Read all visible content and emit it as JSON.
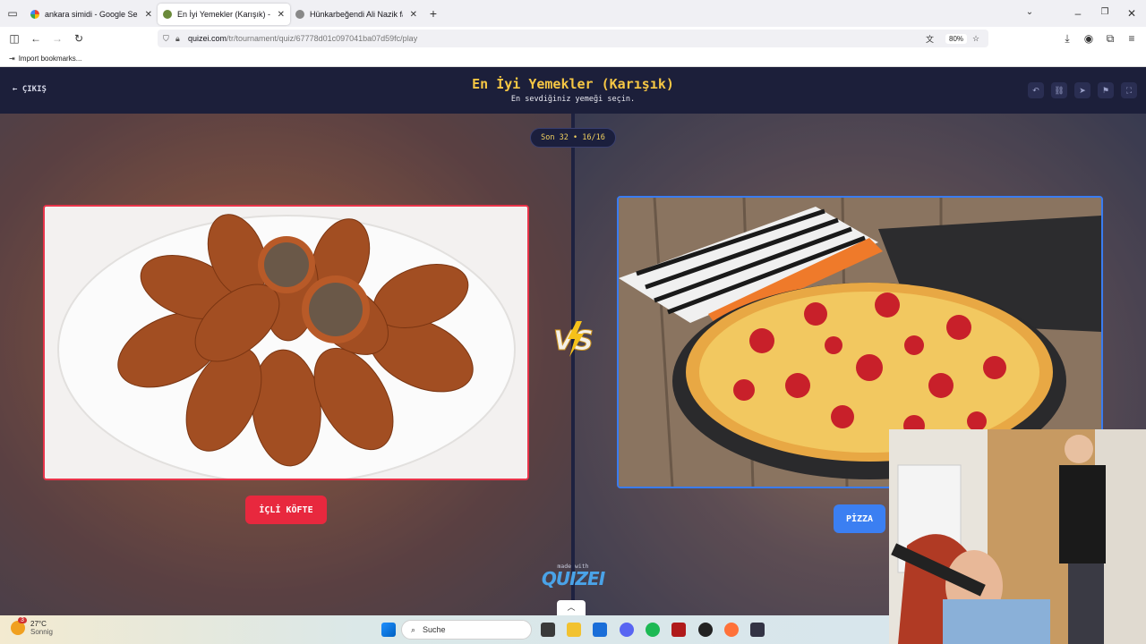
{
  "browser": {
    "tabs": [
      {
        "title": "ankara simidi - Google Search",
        "active": false
      },
      {
        "title": "En İyi Yemekler (Karışık) - Quizei",
        "active": true
      },
      {
        "title": "Hünkarbeğendi Ali Nazik farkı",
        "active": false
      }
    ],
    "url_host": "quizei.com",
    "url_path": "/tr/tournament/quiz/67778d01c097041ba07d59fc/play",
    "zoom": "80%",
    "bookmark_import": "Import bookmarks..."
  },
  "quiz": {
    "exit_label": "ÇIKIŞ",
    "title": "En İyi Yemekler (Karışık)",
    "subtitle": "En sevdiğiniz yemeği seçin.",
    "round": "Son 32 • 16/16",
    "vs_label": "VS",
    "left_choice": "İÇLİ KÖFTE",
    "right_choice": "PİZZA",
    "made_with": "made with",
    "brand": "QUIZEI",
    "accent_left": "#e8283e",
    "accent_right": "#3b7ff2",
    "title_color": "#f6c744"
  },
  "taskbar": {
    "temperature": "27°C",
    "weather_text": "Sonnig",
    "weather_badge": "3",
    "search_placeholder": "Suche"
  }
}
